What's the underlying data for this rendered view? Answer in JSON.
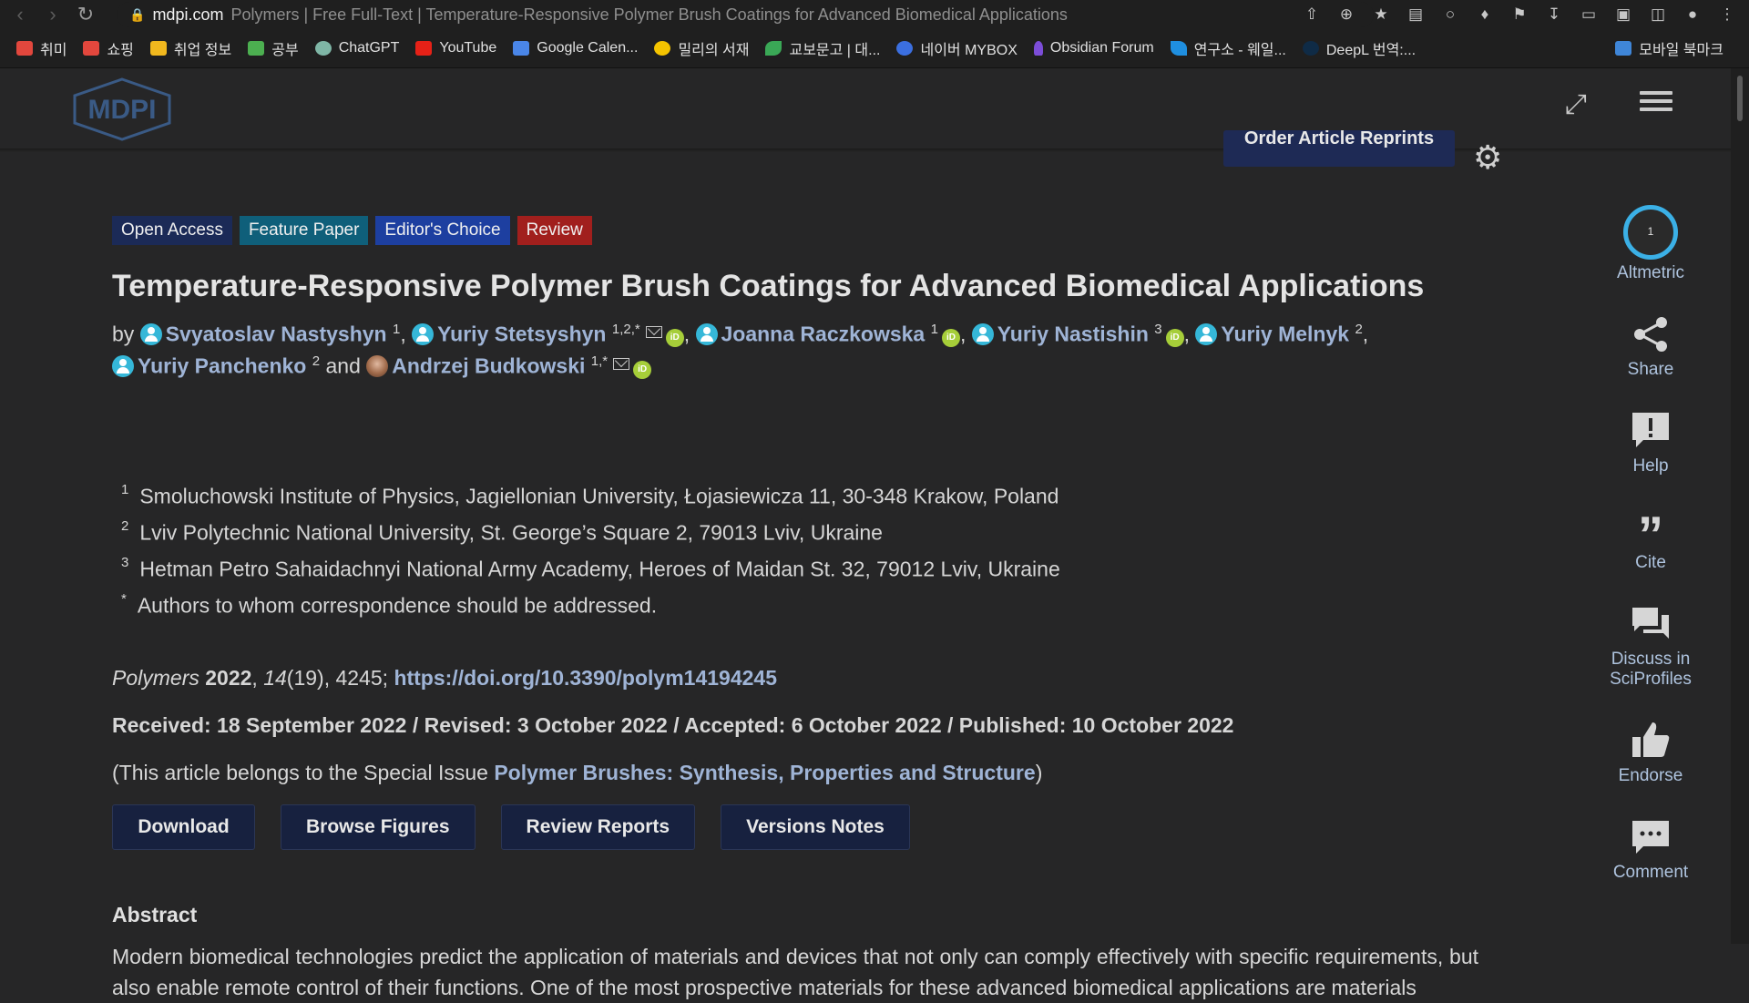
{
  "browser": {
    "domain": "mdpi.com",
    "tab_title": "Polymers | Free Full-Text | Temperature-Responsive Polymer Brush Coatings for Advanced Biomedical Applications",
    "bookmarks": [
      {
        "label": "취미",
        "icon": "folder-icon"
      },
      {
        "label": "쇼핑",
        "icon": "folder-icon"
      },
      {
        "label": "취업 정보",
        "icon": "folder-icon"
      },
      {
        "label": "공부",
        "icon": "folder-icon"
      },
      {
        "label": "ChatGPT",
        "icon": "chatgpt-icon"
      },
      {
        "label": "YouTube",
        "icon": "youtube-icon"
      },
      {
        "label": "Google Calen...",
        "icon": "calendar-icon"
      },
      {
        "label": "밀리의 서재",
        "icon": "millie-icon"
      },
      {
        "label": "교보문고 | 대...",
        "icon": "kyobo-icon"
      },
      {
        "label": "네이버 MYBOX",
        "icon": "mybox-icon"
      },
      {
        "label": "Obsidian Forum",
        "icon": "obsidian-icon"
      },
      {
        "label": "연구소 - 웨일...",
        "icon": "whale-icon"
      },
      {
        "label": "DeepL 번역:...",
        "icon": "deepl-icon"
      }
    ],
    "mobile_bookmarks": "모바일 북마크"
  },
  "header": {
    "logo_text": "MDPI",
    "order_reprints": "Order Article Reprints"
  },
  "article": {
    "badges": [
      "Open Access",
      "Feature Paper",
      "Editor's Choice",
      "Review"
    ],
    "title": "Temperature-Responsive Polymer Brush Coatings for Advanced Biomedical Applications",
    "by": "by",
    "and": "and",
    "authors": [
      {
        "name": "Svyatoslav Nastyshyn",
        "aff": "1"
      },
      {
        "name": "Yuriy Stetsyshyn",
        "aff": "1,2,*"
      },
      {
        "name": "Joanna Raczkowska",
        "aff": "1"
      },
      {
        "name": "Yuriy Nastishin",
        "aff": "3"
      },
      {
        "name": "Yuriy Melnyk",
        "aff": "2"
      },
      {
        "name": "Yuriy Panchenko",
        "aff": "2"
      },
      {
        "name": "Andrzej Budkowski",
        "aff": "1,*"
      }
    ],
    "affiliations": [
      {
        "mark": "1",
        "text": "Smoluchowski Institute of Physics, Jagiellonian University, Łojasiewicza 11, 30-348 Krakow, Poland"
      },
      {
        "mark": "2",
        "text": "Lviv Polytechnic National University, St. George’s Square 2, 79013 Lviv, Ukraine"
      },
      {
        "mark": "3",
        "text": "Hetman Petro Sahaidachnyi National Army Academy, Heroes of Maidan St. 32, 79012 Lviv, Ukraine"
      },
      {
        "mark": "*",
        "text": "Authors to whom correspondence should be addressed."
      }
    ],
    "citation": {
      "journal": "Polymers",
      "year": "2022",
      "volume": "14",
      "issue_pages": "(19), 4245;",
      "doi": "https://doi.org/10.3390/polym14194245"
    },
    "dates": "Received: 18 September 2022 / Revised: 3 October 2022 / Accepted: 6 October 2022 / Published: 10 October 2022",
    "special_issue": {
      "prefix": "(This article belongs to the Special Issue",
      "name": "Polymer Brushes: Synthesis, Properties and Structure",
      "suffix": ")"
    },
    "buttons": [
      "Download",
      "Browse Figures",
      "Review Reports",
      "Versions Notes"
    ],
    "abstract_heading": "Abstract",
    "abstract_text": "Modern biomedical technologies predict the application of materials and devices that not only can comply effectively with specific requirements, but also enable remote control of their functions. One of the most prospective materials for these advanced biomedical applications are materials"
  },
  "sidebar": {
    "altmetric": "Altmetric",
    "altmetric_score": "1",
    "share": "Share",
    "help": "Help",
    "cite": "Cite",
    "discuss": "Discuss in SciProfiles",
    "endorse": "Endorse",
    "comment": "Comment"
  }
}
